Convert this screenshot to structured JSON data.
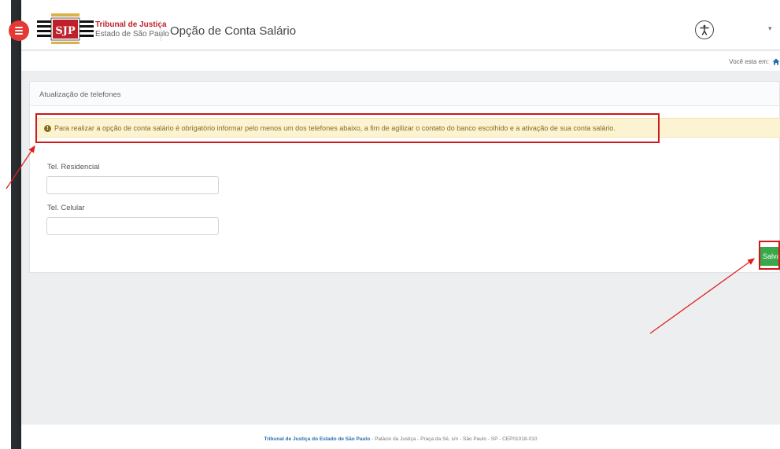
{
  "header": {
    "org_line1": "Tribunal de Justiça",
    "org_line2": "Estado de São Paulo",
    "page_title": "Opção de Conta Salário",
    "menu_icon": "hamburger-icon",
    "accessibility_icon": "accessibility-icon",
    "dropdown_caret": "▾"
  },
  "breadcrumb": {
    "prefix": "Você esta em:",
    "home_icon": "home-icon"
  },
  "panel": {
    "title": "Atualização de telefones",
    "alert": "Para realizar a opção de conta salário é obrigatório informar pelo menos um dos telefones abaixo, a fim de agilizar o contato do banco escolhido e a ativação de sua conta salário.",
    "fields": {
      "residential_label": "Tel. Residencial",
      "residential_value": "",
      "mobile_label": "Tel. Celular",
      "mobile_value": ""
    },
    "save_label": "Salvar"
  },
  "footer": {
    "org": "Tribunal de Justiça do Estado de São Paulo",
    "address": " - Palácio da Justiça - Praça da Sé, s/n - São Paulo - SP - CEP01018-010"
  },
  "colors": {
    "accent_red": "#e53935",
    "highlight_red": "#d01818",
    "alert_bg": "#fcf3d2",
    "save_green": "#3aa84a"
  }
}
